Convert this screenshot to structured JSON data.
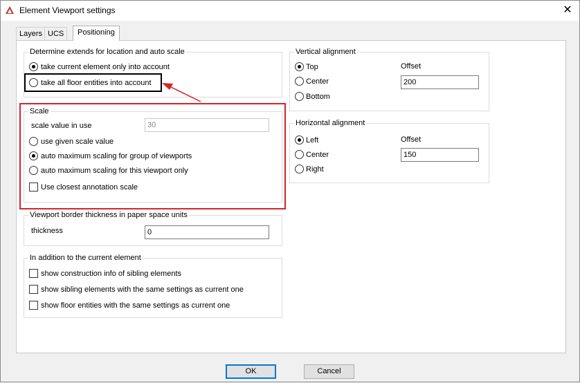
{
  "window": {
    "title": "Element Viewport settings",
    "close_glyph": "✕"
  },
  "tabs": [
    {
      "label": "Layers"
    },
    {
      "label": "UCS"
    },
    {
      "label": "Positioning"
    }
  ],
  "extends": {
    "title": "Determine extends for location and auto scale",
    "opt_current": "take current element only into account",
    "opt_floor": "take all floor entities into account"
  },
  "scale": {
    "title": "Scale",
    "value_label": "scale value in use",
    "value": "30",
    "opt_given": "use given scale value",
    "opt_group": "auto maximum scaling for group of viewports",
    "opt_this": "auto maximum scaling for this viewport only",
    "closest_annotation": "Use closest annotation scale"
  },
  "border": {
    "title": "Viewport border thickness in paper space units",
    "thickness_label": "thickness",
    "thickness_value": "0"
  },
  "addition": {
    "title": "In addition to the current element",
    "construction": "show construction info of sibling elements",
    "siblings": "show sibling elements with the same settings as current one",
    "floor": "show floor entities with the same settings as current one"
  },
  "vertical": {
    "title": "Vertical alignment",
    "top": "Top",
    "center": "Center",
    "bottom": "Bottom",
    "offset_label": "Offset",
    "offset_value": "200"
  },
  "horizontal": {
    "title": "Horizontal alignment",
    "left": "Left",
    "center": "Center",
    "right": "Right",
    "offset_label": "Offset",
    "offset_value": "150"
  },
  "buttons": {
    "ok": "OK",
    "cancel": "Cancel"
  },
  "colors": {
    "annotation_red": "#d6222a",
    "default_button_accent": "#0078d7"
  }
}
